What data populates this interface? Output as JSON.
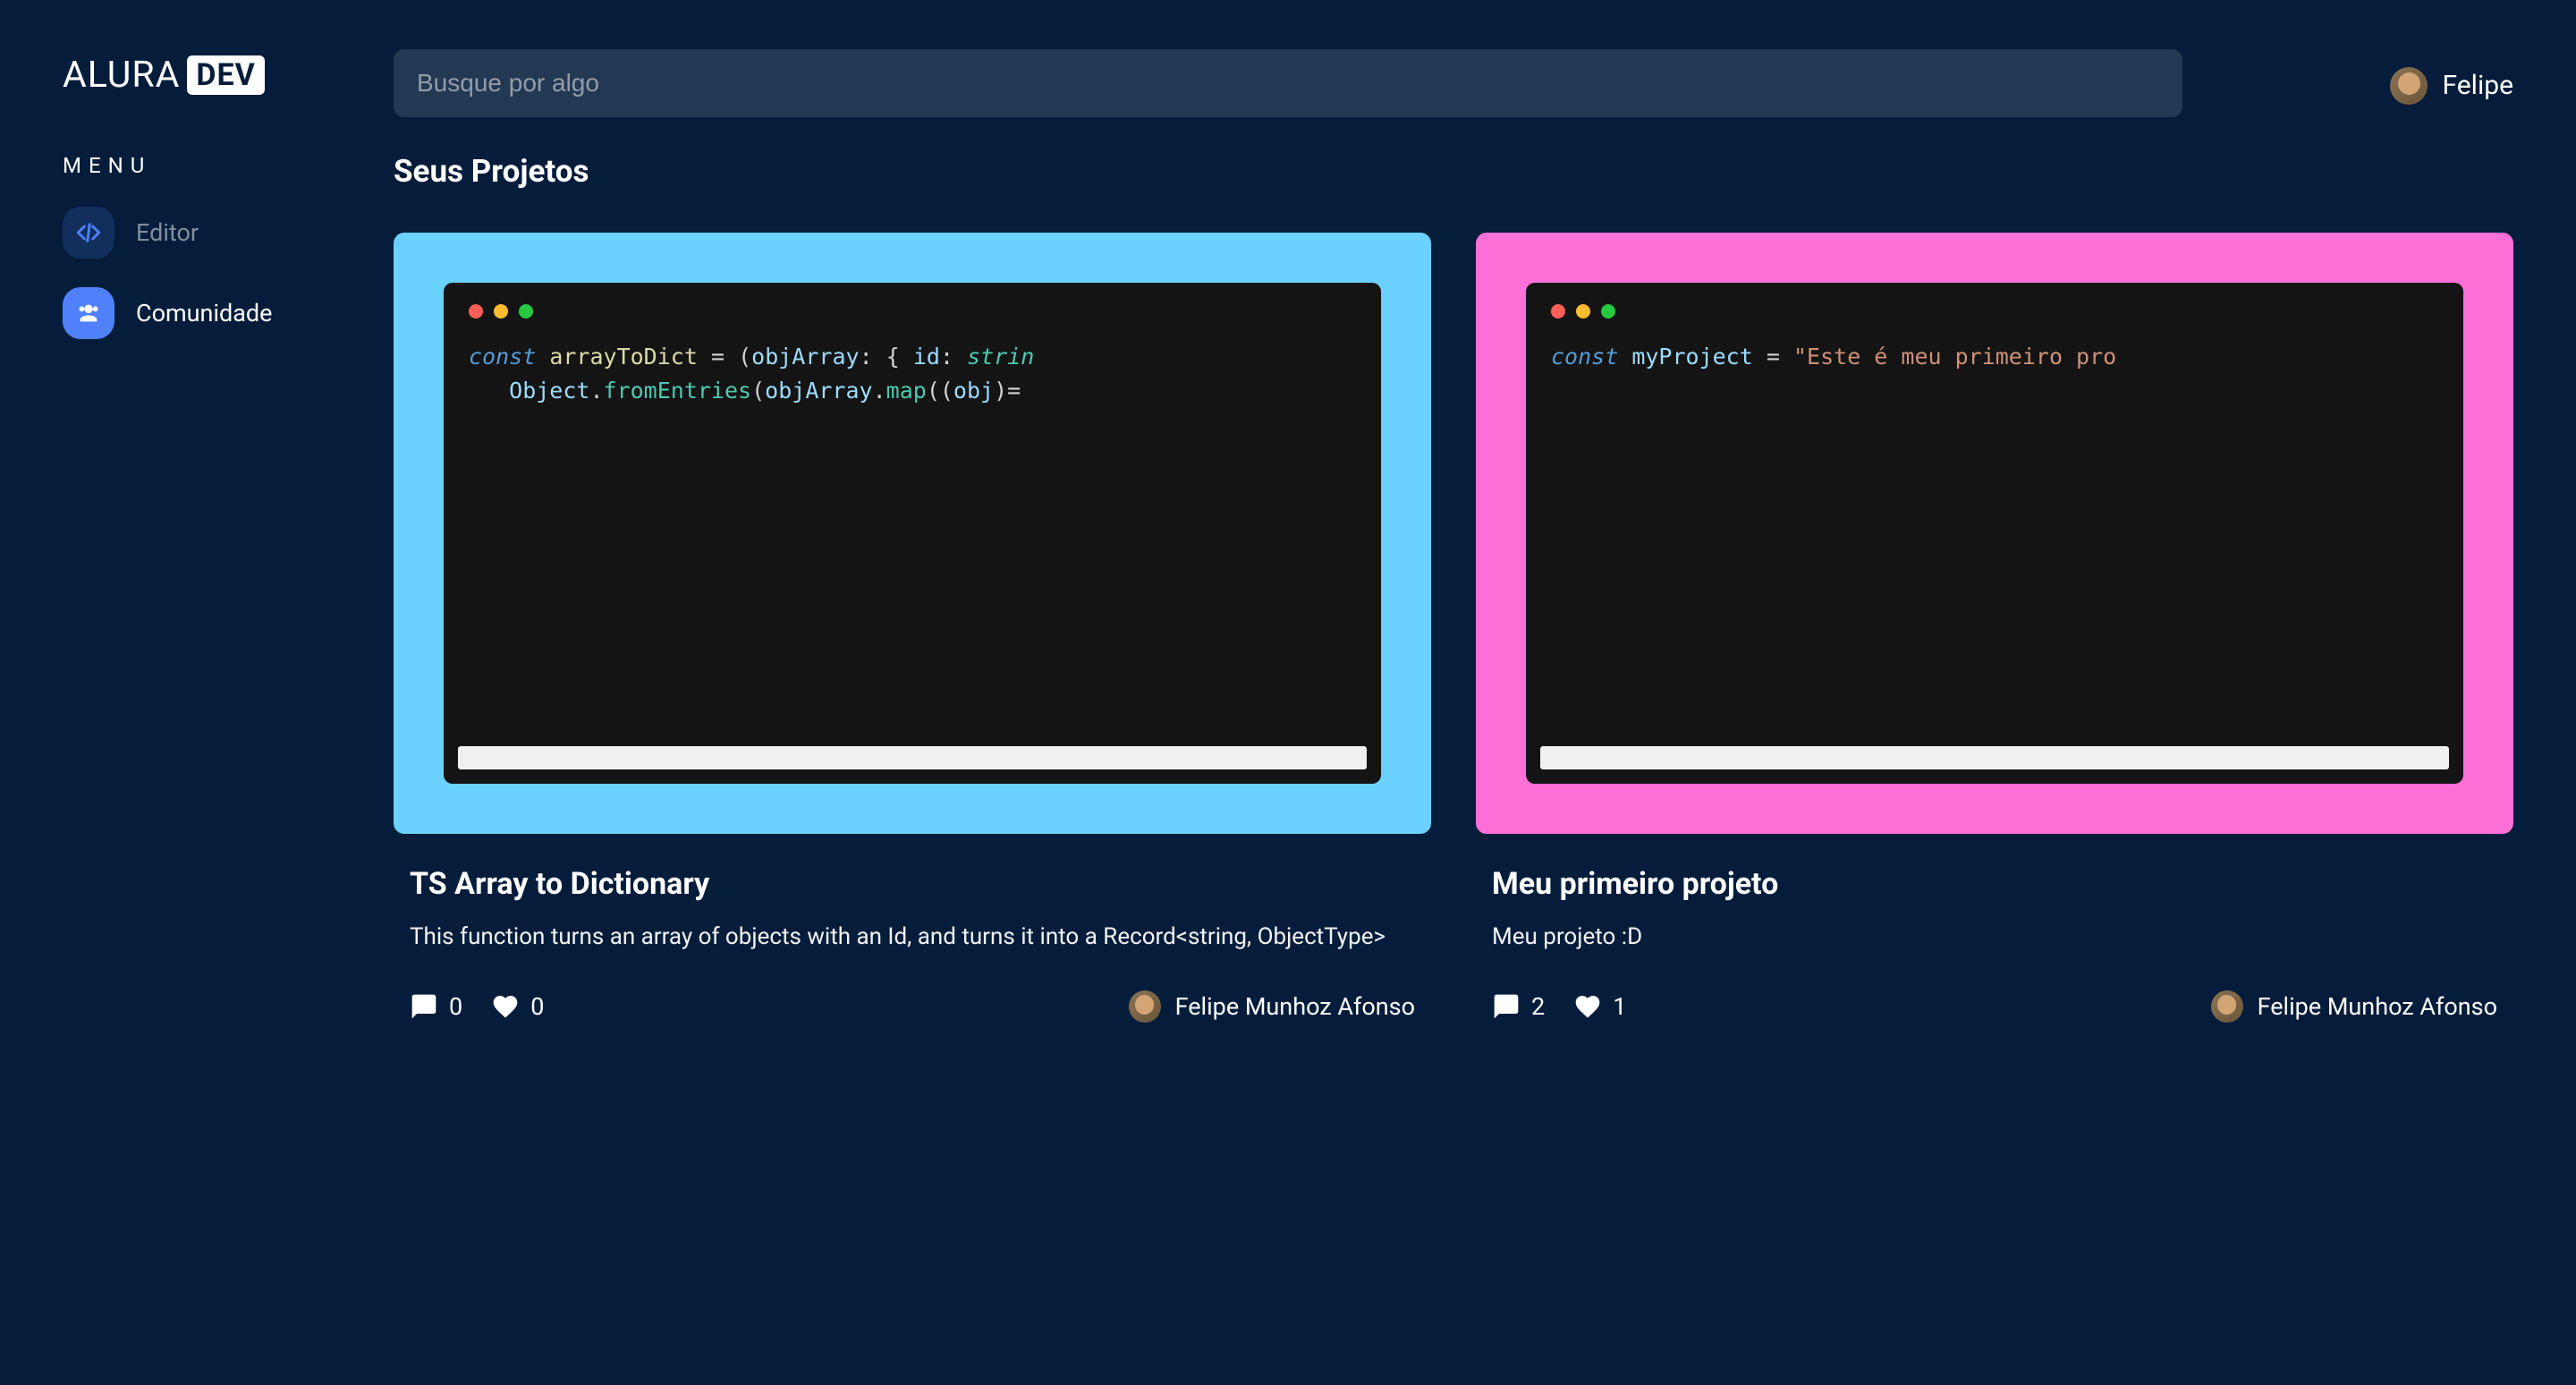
{
  "logo": {
    "text": "ALURA",
    "badge": "DEV"
  },
  "search": {
    "placeholder": "Busque por algo"
  },
  "user": {
    "name": "Felipe"
  },
  "sidebar": {
    "menu_label": "MENU",
    "items": [
      {
        "label": "Editor",
        "active": false
      },
      {
        "label": "Comunidade",
        "active": true
      }
    ]
  },
  "page": {
    "title": "Seus Projetos"
  },
  "projects": [
    {
      "frame_color": "#6bd1ff",
      "title": "TS Array to Dictionary",
      "description": "This function turns an array of objects with an Id, and turns it into a Record<string, ObjectType>",
      "comments": 0,
      "likes": 0,
      "author": "Felipe Munhoz Afonso",
      "code_html": "<span class='kw'>const</span> <span class='fn'>arrayToDict</span> <span class='punct'>=</span> <span class='punct'>(</span><span class='var'>objArray</span><span class='punct'>:</span> <span class='punct'>{</span> <span class='prop'>id</span><span class='punct'>:</span> <span class='type'>strin</span>\n   <span class='var'>Object</span><span class='punct'>.</span><span class='method'>fromEntries</span><span class='punct'>(</span><span class='var'>objArray</span><span class='punct'>.</span><span class='method'>map</span><span class='punct'>((</span><span class='var'>obj</span><span class='punct'>)=</span>"
    },
    {
      "frame_color": "#ff6fd8",
      "title": "Meu primeiro projeto",
      "description": "Meu projeto :D",
      "comments": 2,
      "likes": 1,
      "author": "Felipe Munhoz Afonso",
      "code_html": "<span class='kw'>const</span> <span class='var'>myProject</span> <span class='punct'>=</span> <span class='str'>\"Este é meu primeiro pro</span>"
    }
  ]
}
